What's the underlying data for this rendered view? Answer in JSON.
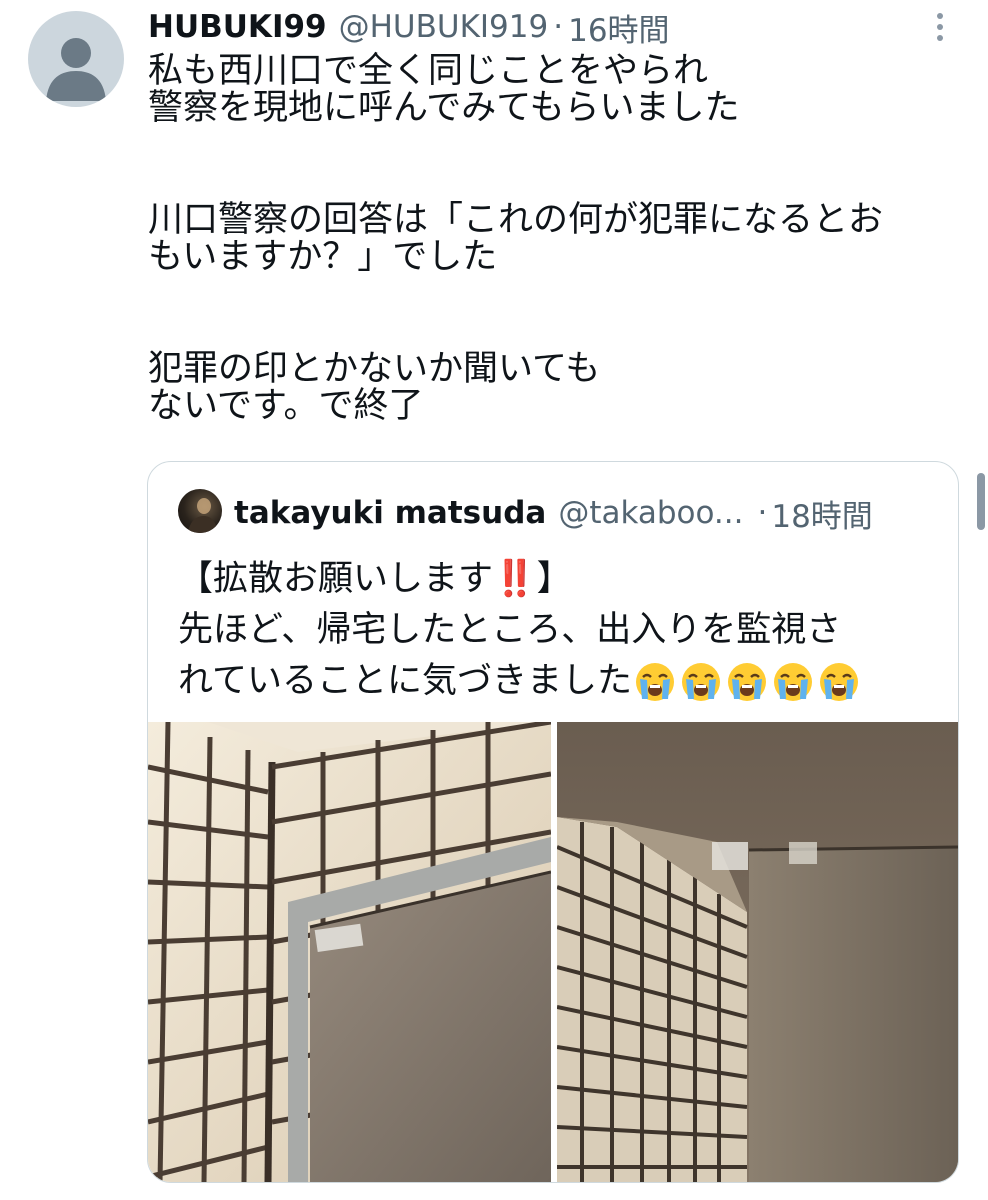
{
  "tweet": {
    "display_name": "HUBUKI99",
    "handle": "@HUBUKI919",
    "separator": "·",
    "time": "16時間",
    "lines": [
      "私も西川口で全く同じことをやられ",
      "警察を現地に呼んでみてもらいました",
      "",
      "川口警察の回答は「これの何が犯罪になるとお",
      "もいますか？」でした",
      "",
      "犯罪の印とかないか聞いても",
      "ないです。で終了"
    ]
  },
  "quote": {
    "display_name": "takayuki matsuda",
    "handle": "@takaboo...",
    "separator": "·",
    "time": "18時間",
    "line1_pre": "【拡散お願いします",
    "line1_bang": "‼️",
    "line1_post": "】",
    "line2": "先ほど、帰宅したところ、出入りを監視さ",
    "line3": "れていることに気づきました",
    "emoji_icon": "loudly-crying-face-icon",
    "emoji_count": 5,
    "images": [
      "tiled-wall-door-photo",
      "door-top-tape-photo"
    ]
  },
  "colors": {
    "text": "#0f1419",
    "muted": "#536471",
    "border": "#cfd9de",
    "bang": "#e0245e"
  }
}
